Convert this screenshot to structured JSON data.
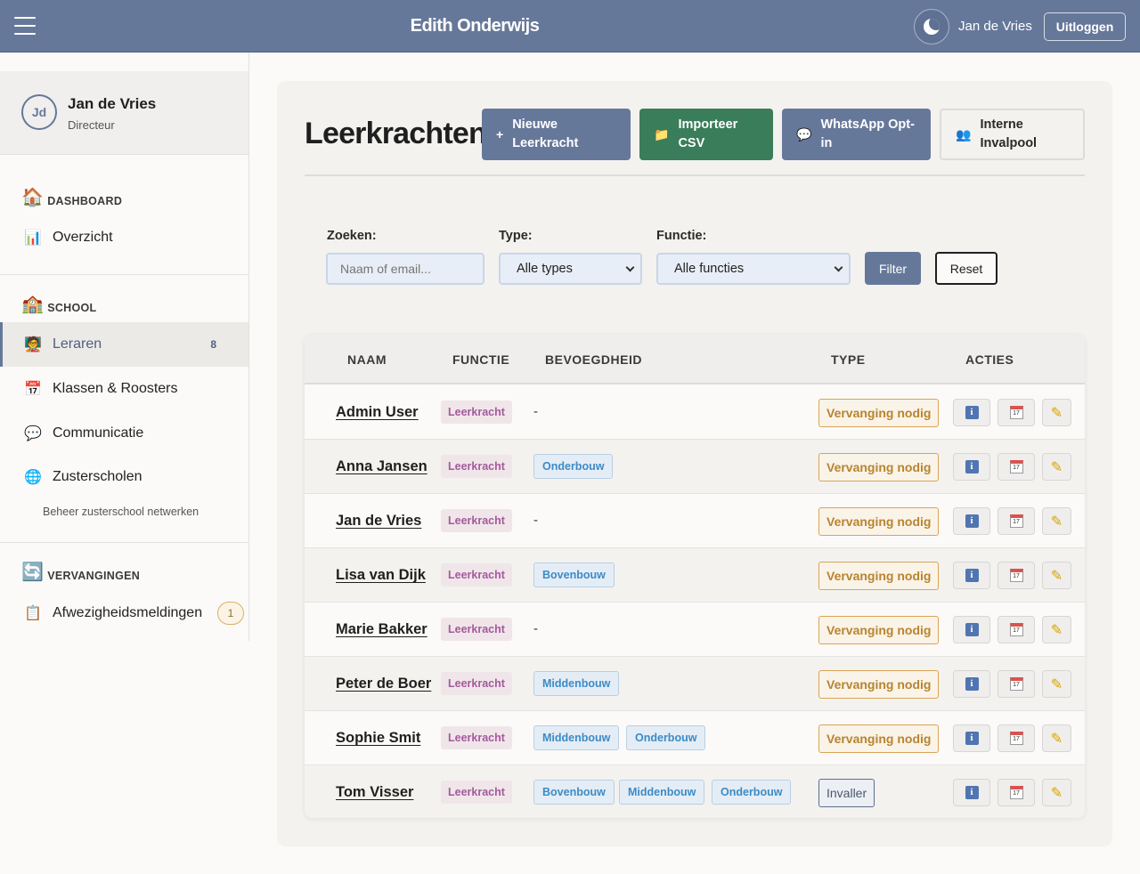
{
  "header": {
    "title": "Edith Onderwijs",
    "user": "Jan de Vries",
    "logout_label": "Uitloggen"
  },
  "sidebar": {
    "profile": {
      "initials": "Jd",
      "name": "Jan de Vries",
      "role": "Directeur"
    },
    "sections": {
      "dashboard": "DASHBOARD",
      "school": "SCHOOL",
      "vervangingen": "VERVANGINGEN"
    },
    "items": {
      "overzicht": "Overzicht",
      "leraren": "Leraren",
      "leraren_count": "8",
      "klassen": "Klassen & Roosters",
      "communicatie": "Communicatie",
      "zusterscholen": "Zusterscholen",
      "zusterscholen_sub": "Beheer zusterschool netwerken",
      "afwezigheid": "Afwezigheidsmeldingen",
      "afwezigheid_count": "1"
    }
  },
  "main": {
    "title": "Leerkrachten",
    "buttons": {
      "new_line1": "Nieuwe",
      "new_line2": "Leerkracht",
      "import_line1": "Importeer",
      "import_line2": "CSV",
      "whatsapp_line1": "WhatsApp Opt-",
      "whatsapp_line2": "in",
      "pool_line1": "Interne",
      "pool_line2": "Invalpool"
    },
    "filters": {
      "search_label": "Zoeken:",
      "search_placeholder": "Naam of email...",
      "type_label": "Type:",
      "type_value": "Alle types",
      "function_label": "Functie:",
      "function_value": "Alle functies",
      "filter_label": "Filter",
      "reset_label": "Reset"
    },
    "table": {
      "headers": {
        "naam": "NAAM",
        "functie": "FUNCTIE",
        "bevoegdheid": "BEVOEGDHEID",
        "type": "TYPE",
        "acties": "ACTIES"
      },
      "rows": [
        {
          "name": "Admin User",
          "functie": "Leerkracht",
          "bevoegdheid": [],
          "empty": "-",
          "type": "Vervanging nodig"
        },
        {
          "name": "Anna Jansen",
          "functie": "Leerkracht",
          "bevoegdheid": [
            "Onderbouw"
          ],
          "empty": "",
          "type": "Vervanging nodig"
        },
        {
          "name": "Jan de Vries",
          "functie": "Leerkracht",
          "bevoegdheid": [],
          "empty": "-",
          "type": "Vervanging nodig"
        },
        {
          "name": "Lisa van Dijk",
          "functie": "Leerkracht",
          "bevoegdheid": [
            "Bovenbouw"
          ],
          "empty": "",
          "type": "Vervanging nodig"
        },
        {
          "name": "Marie Bakker",
          "functie": "Leerkracht",
          "bevoegdheid": [],
          "empty": "-",
          "type": "Vervanging nodig"
        },
        {
          "name": "Peter de Boer",
          "functie": "Leerkracht",
          "bevoegdheid": [
            "Middenbouw"
          ],
          "empty": "",
          "type": "Vervanging nodig"
        },
        {
          "name": "Sophie Smit",
          "functie": "Leerkracht",
          "bevoegdheid": [
            "Middenbouw",
            "Onderbouw"
          ],
          "empty": "",
          "type": "Vervanging nodig"
        },
        {
          "name": "Tom Visser",
          "functie": "Leerkracht",
          "bevoegdheid": [
            "Bovenbouw",
            "Middenbouw",
            "Onderbouw"
          ],
          "empty": "",
          "type": "Invaller"
        }
      ]
    }
  },
  "colors": {
    "header_bg": "#66789a",
    "green_button": "#3a7d5a",
    "warning": "#b8842f",
    "tag_blue": "#3c8bc5",
    "tag_purple": "#a45a9b"
  },
  "icons": {
    "menu": "hamburger-icon",
    "theme": "moon-icon",
    "dashboard": "house-icon",
    "overzicht": "bar-chart-icon",
    "school": "school-building-icon",
    "leraren": "teacher-icon",
    "klassen": "calendar-icon",
    "communicatie": "speech-bubble-icon",
    "zusterscholen": "globe-icon",
    "vervangingen": "refresh-icon",
    "afwezigheid": "clipboard-icon",
    "import": "folder-icon",
    "whatsapp": "speech-bubble-icon",
    "pool": "people-icon",
    "info": "info-icon",
    "calendar": "calendar-icon",
    "edit": "pencil-icon"
  }
}
